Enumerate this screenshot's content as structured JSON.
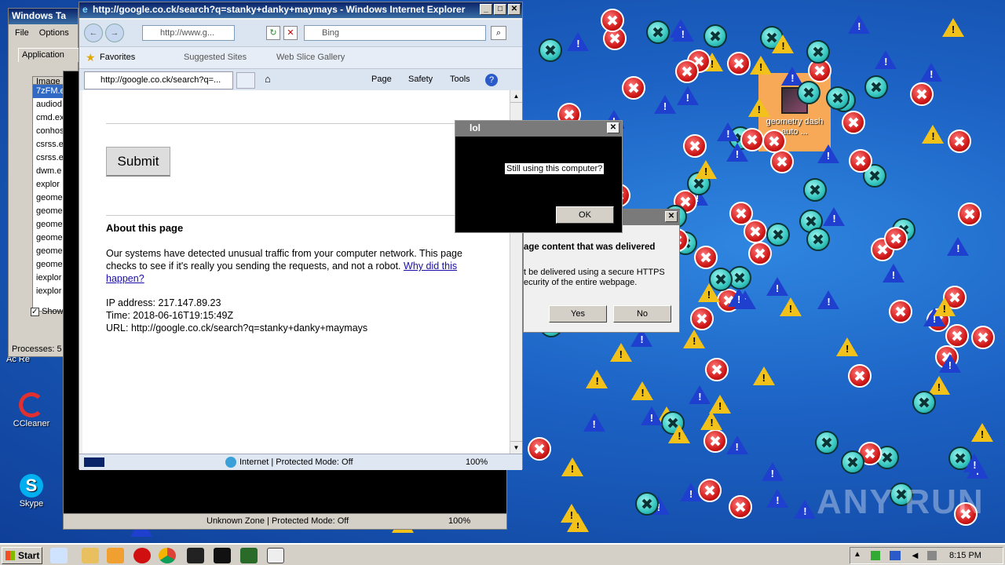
{
  "desktop": {
    "icons": [
      {
        "label": "CCleaner",
        "icon": "ccleaner-icon"
      },
      {
        "label": "Skype",
        "icon": "skype-icon"
      }
    ],
    "selected_icon_label": "geometry dash auto ...",
    "partial_text": "Ac Re",
    "watermark": "ANY RUN"
  },
  "taskmgr": {
    "title": "Windows Ta",
    "menu": [
      "File",
      "Options"
    ],
    "tab": "Application",
    "column": "Image",
    "processes": [
      "7zFM.e",
      "audiod",
      "cmd.ex",
      "conhos",
      "csrss.e",
      "csrss.e",
      "dwm.e",
      "explor",
      "geome",
      "geome",
      "geome",
      "geome",
      "geome",
      "geome",
      "iexplor",
      "iexplor"
    ],
    "show_label": "Show",
    "status": "Processes: 5"
  },
  "ie_back": {
    "status_zone": "Unknown Zone | Protected Mode: Off",
    "zoom": "100%"
  },
  "ie": {
    "title": "http://google.co.ck/search?q=stanky+danky+maymays - Windows Internet Explorer",
    "address": "http://www.g...",
    "search_placeholder": "Bing",
    "favorites_label": "Favorites",
    "suggested_sites": "Suggested Sites",
    "web_slice": "Web Slice Gallery",
    "tab_label": "http://google.co.ck/search?q=...",
    "commands": [
      "Page",
      "Safety",
      "Tools"
    ],
    "status_zone": "Internet | Protected Mode: Off",
    "zoom": "100%",
    "page": {
      "submit_label": "Submit",
      "about_heading": "About this page",
      "body_text": "Our systems have detected unusual traffic from your computer network. This page checks to see if it's really you sending the requests, and not a robot.",
      "why_link": "Why did this happen?",
      "ip_line": "IP address: 217.147.89.23",
      "time_line": "Time: 2018-06-16T19:15:49Z",
      "url_line": "URL: http://google.co.ck/search?q=stanky+danky+maymays"
    }
  },
  "lol_dialog": {
    "title": "lol",
    "message": "Still using this computer?",
    "ok_label": "OK"
  },
  "cert_dialog": {
    "heading": "age content that was delivered",
    "body": "t be delivered using a secure HTTPS ecurity of the entire webpage.",
    "yes_label": "Yes",
    "no_label": "No"
  },
  "taskbar": {
    "start_label": "Start",
    "clock": "8:15 PM"
  }
}
